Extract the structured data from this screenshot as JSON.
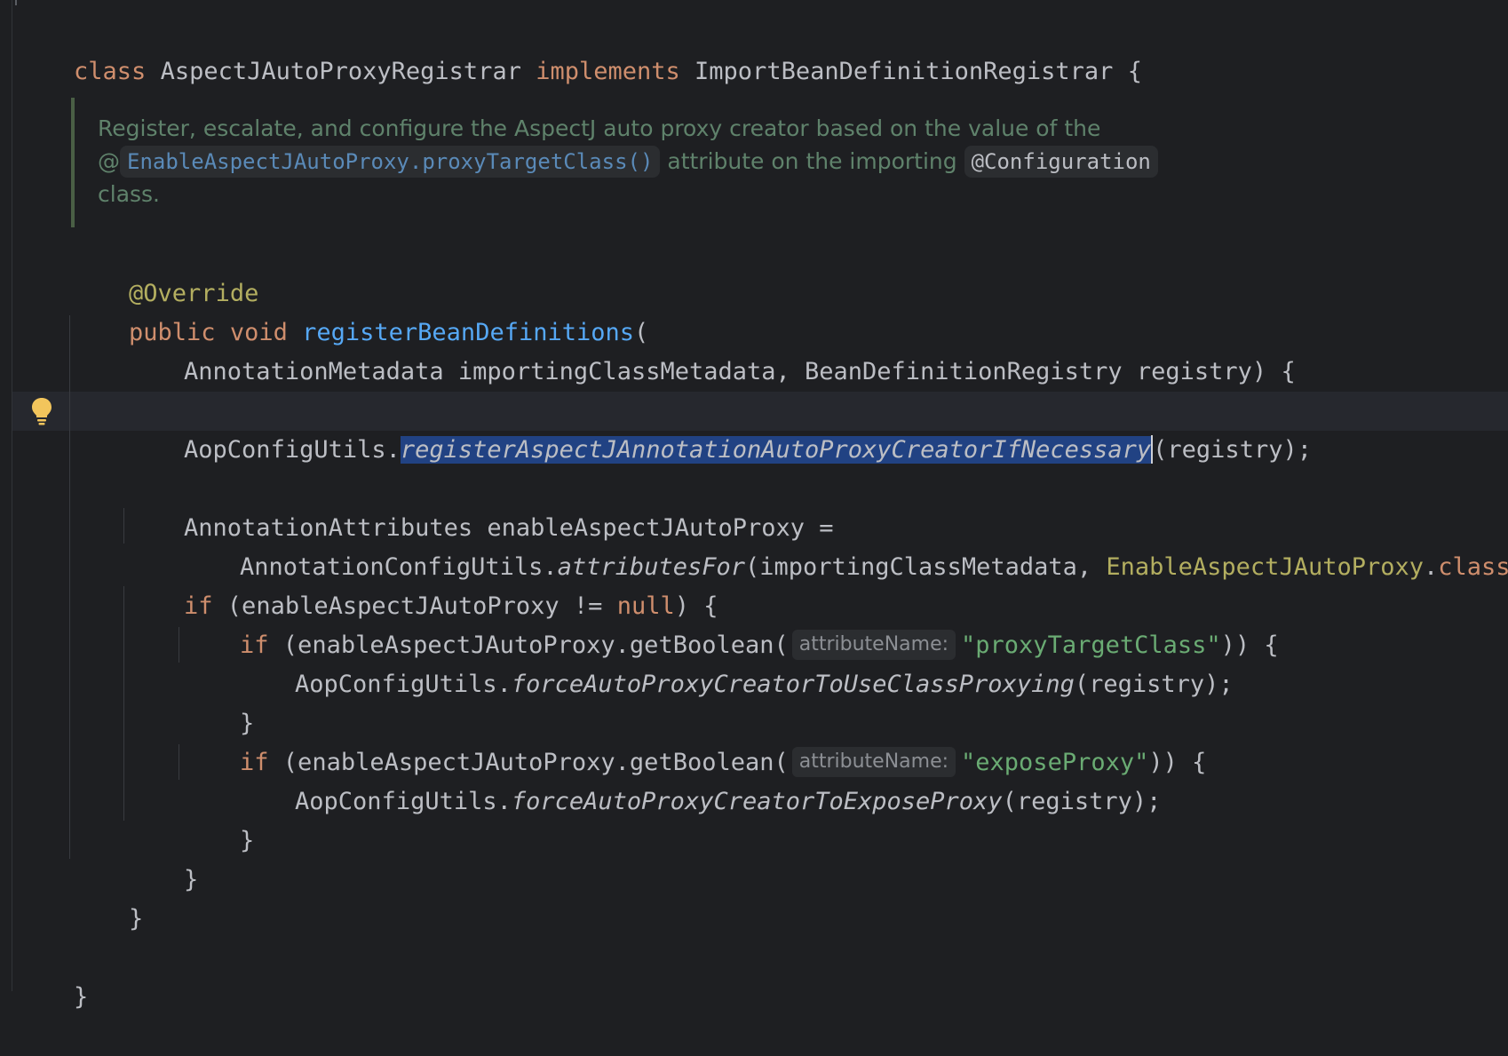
{
  "editor": {
    "colors": {
      "background": "#1e1f22",
      "keyword": "#cf8e6d",
      "annotation": "#b3ae60",
      "function": "#56a8f5",
      "string": "#6aab73",
      "doc": "#5f826b",
      "selection": "#214283"
    },
    "line1": {
      "kw_class": "class",
      "name": " AspectJAutoProxyRegistrar ",
      "kw_implements": "implements",
      "iface": " ImportBeanDefinitionRegistrar {"
    },
    "doc": {
      "line1": "Register, escalate, and configure the AspectJ auto proxy creator based on the value of the",
      "line2_prefix": "@",
      "line2_link": "EnableAspectJAutoProxy.proxyTargetClass()",
      "line2_mid": " attribute on the importing ",
      "line2_code": "@Configuration",
      "line3": "class."
    },
    "override": "@Override",
    "method_sig": {
      "kw_public": "public",
      "kw_void": " void ",
      "name": "registerBeanDefinitions",
      "open": "("
    },
    "params": "AnnotationMetadata importingClassMetadata, BeanDefinitionRegistry registry) {",
    "register_line": {
      "prefix": "AopConfigUtils.",
      "selected": "registerAspectJAnnotationAutoProxyCreatorIfNecessary",
      "suffix": "(registry);"
    },
    "attrs_line": "AnnotationAttributes enableAspectJAutoProxy =",
    "attrs_cont": {
      "prefix": "AnnotationConfigUtils.",
      "method": "attributesFor",
      "args": "(importingClassMetadata, ",
      "cls": "EnableAspectJAutoProxy",
      "dot": ".",
      "kw_class": "class",
      "end": ");"
    },
    "if_null": {
      "kw_if": "if",
      "cond": " (enableAspectJAutoProxy != ",
      "kw_null": "null",
      "end": ") {"
    },
    "if_ptc": {
      "kw_if": "if",
      "call": " (enableAspectJAutoProxy.getBoolean(",
      "hint": "attributeName:",
      "str": "\"proxyTargetClass\"",
      "end": ")) {"
    },
    "force_class": {
      "prefix": "AopConfigUtils.",
      "method": "forceAutoProxyCreatorToUseClassProxying",
      "suffix": "(registry);"
    },
    "close1": "}",
    "if_expose": {
      "kw_if": "if",
      "call": " (enableAspectJAutoProxy.getBoolean(",
      "hint": "attributeName:",
      "str": "\"exposeProxy\"",
      "end": ")) {"
    },
    "force_expose": {
      "prefix": "AopConfigUtils.",
      "method": "forceAutoProxyCreatorToExposeProxy",
      "suffix": "(registry);"
    },
    "close2": "}",
    "close3": "}",
    "close4": "}",
    "close5": "}",
    "gutter_icon": "lightbulb-icon"
  }
}
